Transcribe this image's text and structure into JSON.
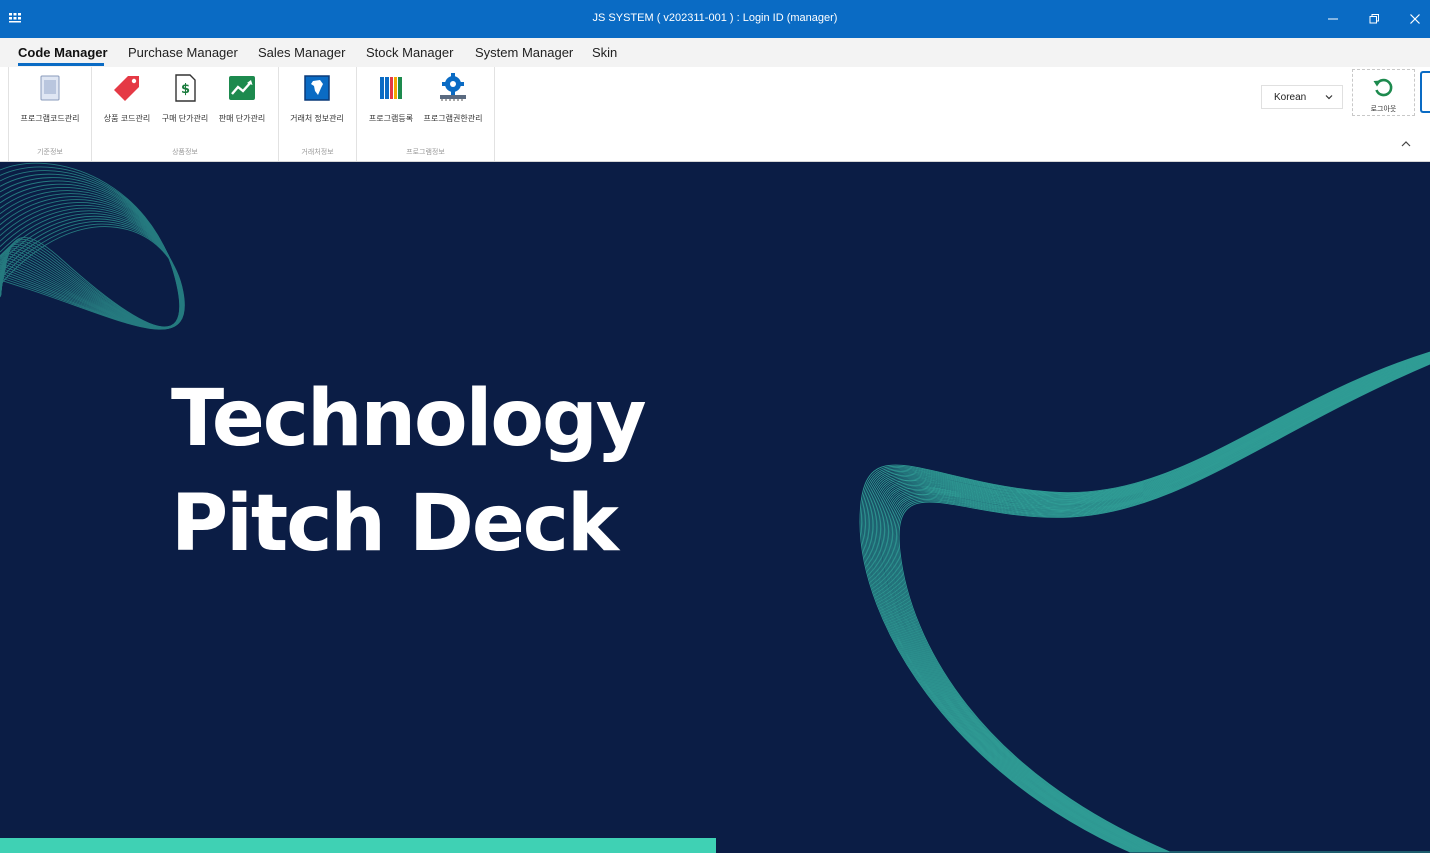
{
  "window": {
    "title": "JS SYSTEM ( v202311-001 ) : Login ID (manager)",
    "controls": [
      "minimize-icon",
      "restore-icon",
      "close-icon"
    ]
  },
  "menu": {
    "tabs": [
      {
        "label": "Code Manager",
        "active": true
      },
      {
        "label": "Purchase Manager"
      },
      {
        "label": "Sales Manager"
      },
      {
        "label": "Stock Manager"
      },
      {
        "label": "System Manager"
      },
      {
        "label": "Skin"
      }
    ]
  },
  "ribbon": {
    "groups": [
      {
        "label": "기준정보",
        "buttons": [
          {
            "label": "프로그램코드관리",
            "icon": "document-icon"
          }
        ]
      },
      {
        "label": "상품정보",
        "buttons": [
          {
            "label": "상품 코드관리",
            "icon": "tag-icon"
          },
          {
            "label": "구매 단가관리",
            "icon": "dollar-document-icon"
          },
          {
            "label": "판매 단가관리",
            "icon": "trend-chart-icon"
          }
        ]
      },
      {
        "label": "거래처정보",
        "buttons": [
          {
            "label": "거래처 정보관리",
            "icon": "map-icon"
          }
        ]
      },
      {
        "label": "프로그램정보",
        "buttons": [
          {
            "label": "프로그램등록",
            "icon": "books-icon"
          },
          {
            "label": "프로그램권한관리",
            "icon": "gear-chip-icon"
          }
        ]
      }
    ],
    "language": {
      "value": "Korean"
    },
    "logout": {
      "label": "로그아웃",
      "icon": "refresh-icon"
    }
  },
  "slide": {
    "title_line1": "Technology",
    "title_line2": "Pitch Deck",
    "colors": {
      "background": "#0b1d45",
      "accent": "#3fd1b4",
      "wave": "#3cc7b0"
    }
  }
}
